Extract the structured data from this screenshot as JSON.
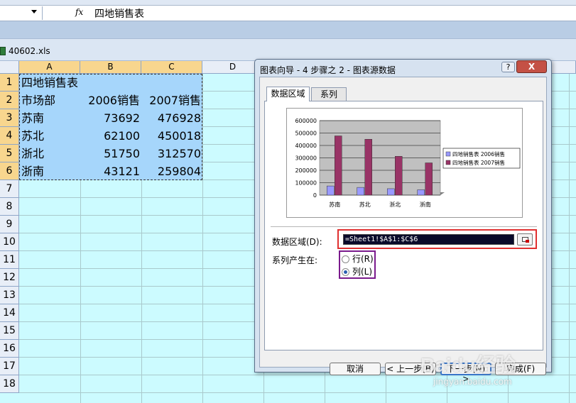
{
  "formula_bar": {
    "fx_label": "fx",
    "formula": "四地销售表"
  },
  "workbook": {
    "file_name": "40602.xls"
  },
  "grid": {
    "columns": [
      "A",
      "B",
      "C",
      "D"
    ],
    "rows": [
      "1",
      "2",
      "3",
      "4",
      "5",
      "6",
      "7",
      "8",
      "9",
      "10",
      "11",
      "12",
      "13",
      "14",
      "15",
      "16",
      "17",
      "18"
    ],
    "cells": [
      [
        "四地销售表",
        "",
        ""
      ],
      [
        "市场部",
        "2006销售",
        "2007销售"
      ],
      [
        "苏南",
        "73692",
        "476928"
      ],
      [
        "苏北",
        "62100",
        "450018"
      ],
      [
        "浙北",
        "51750",
        "312570"
      ],
      [
        "浙南",
        "43121",
        "259804"
      ]
    ]
  },
  "dialog": {
    "title": "图表向导 - 4 步骤之 2 - 图表源数据",
    "help_label": "?",
    "close_label": "X",
    "tabs": {
      "data_range": "数据区域",
      "series": "系列"
    },
    "data_range_label": "数据区域(D):",
    "data_range_value": "=Sheet1!$A$1:$C$6",
    "series_in_label": "系列产生在:",
    "series_options": {
      "rows": "行(R)",
      "columns": "列(L)"
    },
    "selected_series_option": "columns",
    "buttons": {
      "cancel": "取消",
      "back": "< 上一步(B)",
      "next": "下一步(N) >",
      "finish": "完成(F)"
    }
  },
  "chart_data": {
    "type": "bar",
    "categories": [
      "苏南",
      "苏北",
      "浙北",
      "浙南"
    ],
    "series": [
      {
        "name": "四地销售表 2006销售",
        "values": [
          73692,
          62100,
          51750,
          43121
        ],
        "color": "#9999ff"
      },
      {
        "name": "四地销售表 2007销售",
        "values": [
          476928,
          450018,
          312570,
          259804
        ],
        "color": "#993366"
      }
    ],
    "y_ticks": [
      "600000",
      "500000",
      "400000",
      "300000",
      "200000",
      "100000",
      "0"
    ],
    "ylim": [
      0,
      600000
    ],
    "plot_background": "#c0c0c0",
    "legend_position": "right"
  },
  "watermark": {
    "main": "Baidu经验",
    "sub": "jingyan.baidu.com"
  },
  "colors": {
    "grid_bg": "#ccfbff",
    "selection": "#a6d6fb",
    "header_selected": "#f8d68e",
    "highlight_red": "#e03030",
    "highlight_purple": "#7a1a8c"
  }
}
